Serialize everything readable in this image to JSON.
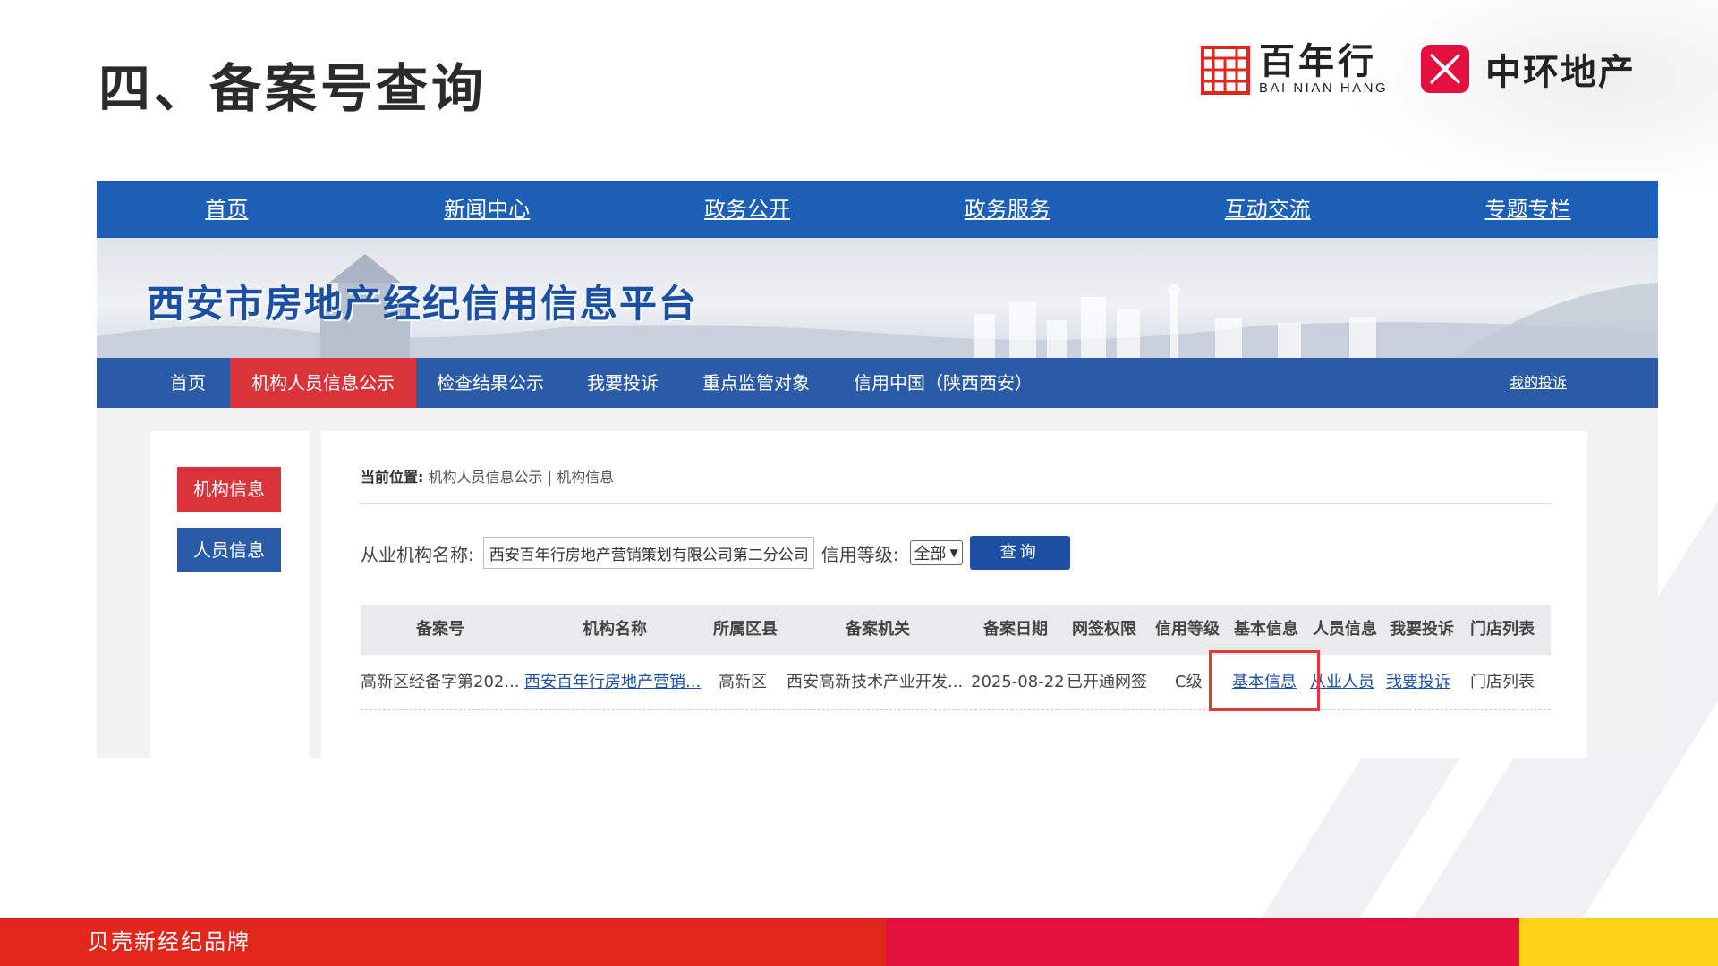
{
  "slide": {
    "title": "四、备案号查询",
    "footer_text": "贝壳新经纪品牌"
  },
  "logos": {
    "bnh_cn": "百年行",
    "bnh_en": "BAI NIAN HANG",
    "zh_cn": "中环地产"
  },
  "site": {
    "top_nav": [
      "首页",
      "新闻中心",
      "政务公开",
      "政务服务",
      "互动交流",
      "专题专栏"
    ],
    "banner_title": "西安市房地产经纪信用信息平台",
    "sub_nav": {
      "items": [
        "首页",
        "机构人员信息公示",
        "检查结果公示",
        "我要投诉",
        "重点监管对象",
        "信用中国（陕西西安）"
      ],
      "active": "机构人员信息公示",
      "right_link": "我的投诉"
    },
    "sidebar": {
      "org_info": "机构信息",
      "person_info": "人员信息"
    },
    "breadcrumb": {
      "label": "当前位置:",
      "path": "机构人员信息公示 | 机构信息"
    },
    "search": {
      "org_label": "从业机构名称:",
      "org_value": "西安百年行房地产营销策划有限公司第二分公司",
      "credit_label": "信用等级:",
      "credit_value": "全部",
      "query_button": "查询"
    },
    "table": {
      "headers": [
        "备案号",
        "机构名称",
        "所属区县",
        "备案机关",
        "备案日期",
        "网签权限",
        "信用等级",
        "基本信息",
        "人员信息",
        "我要投诉",
        "门店列表"
      ],
      "rows": [
        [
          "高新区经备字第202...",
          "西安百年行房地产营销...",
          "高新区",
          "西安高新技术产业开发...",
          "2025-08-22",
          "已开通网签",
          "C级",
          "基本信息",
          "从业人员",
          "我要投诉",
          "门店列表"
        ]
      ]
    }
  },
  "colors": {
    "nav_blue": "#1d5fb5",
    "sub_nav_blue": "#2b5aa6",
    "active_red": "#d8343a",
    "highlight_red": "#e0393e",
    "footer_red": "#e1261c",
    "footer_crimson": "#e3103f",
    "footer_yellow": "#ffd21a"
  }
}
